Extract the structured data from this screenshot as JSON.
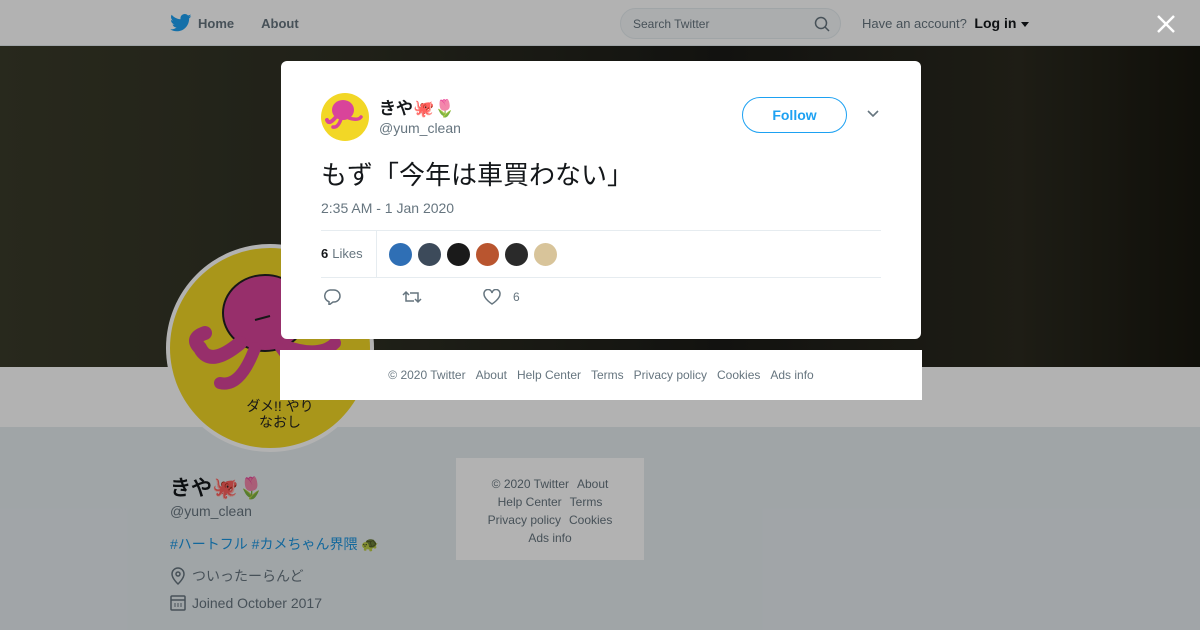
{
  "nav": {
    "home": "Home",
    "about": "About",
    "search_placeholder": "Search Twitter",
    "have_account": "Have an account?",
    "login": "Log in"
  },
  "profile": {
    "name": "きや🐙🌷",
    "handle": "@yum_clean",
    "bio": "#ハートフル #カメちゃん界隈",
    "bio_emoji": "🐢",
    "location": "ついったーらんど",
    "joined": "Joined October 2017",
    "avatar_text": "ダメ!! やりなおし"
  },
  "side_footer": {
    "copyright": "© 2020 Twitter",
    "about": "About",
    "help": "Help Center",
    "terms": "Terms",
    "privacy": "Privacy policy",
    "cookies": "Cookies",
    "ads": "Ads info"
  },
  "tweet": {
    "name": "きや🐙🌷",
    "handle": "@yum_clean",
    "follow_label": "Follow",
    "text": "もず「今年は車買わない」",
    "timestamp": "2:35 AM - 1 Jan 2020",
    "likes_count": "6",
    "likes_label": "Likes",
    "like_action_count": "6",
    "liker_colors": [
      "#2f6fb5",
      "#3c4a5a",
      "#1a1a1a",
      "#b9552f",
      "#2a2a2a",
      "#d8c49a"
    ]
  },
  "modal_footer": {
    "copyright": "© 2020 Twitter",
    "about": "About",
    "help": "Help Center",
    "terms": "Terms",
    "privacy": "Privacy policy",
    "cookies": "Cookies",
    "ads": "Ads info"
  },
  "colors": {
    "accent": "#1da1f2",
    "link": "#1b95e0",
    "avatar_bg": "#f2d726",
    "octopus": "#d9449a"
  }
}
